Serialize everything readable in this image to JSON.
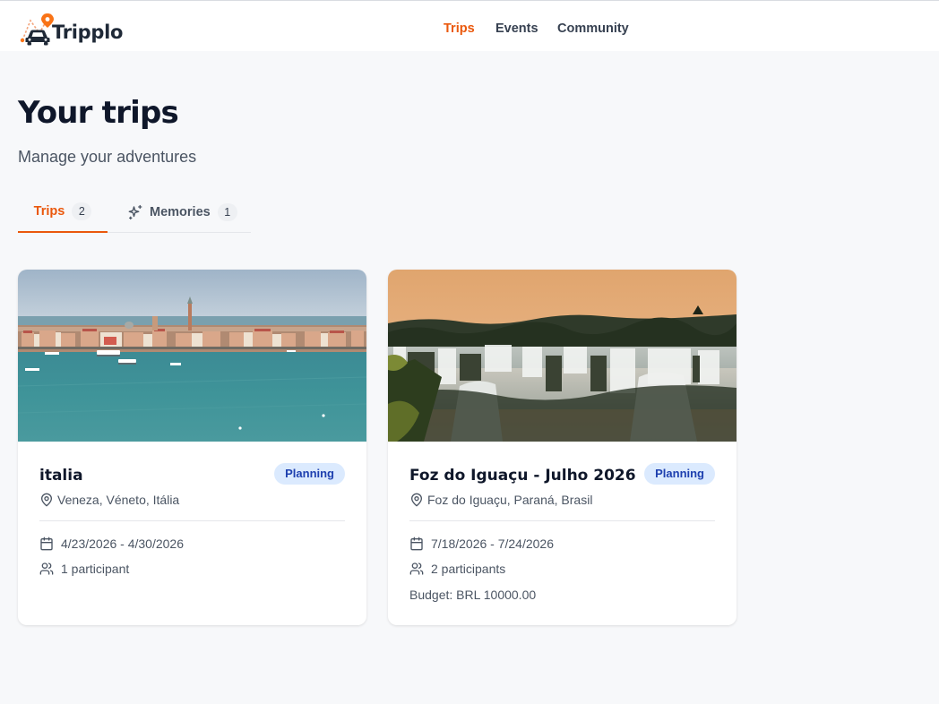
{
  "app": {
    "name": "Tripplo",
    "colors": {
      "accent": "#ea580c",
      "badge_bg": "#dbeafe",
      "badge_text": "#1e40af"
    }
  },
  "nav": {
    "items": [
      {
        "label": "Trips",
        "active": true
      },
      {
        "label": "Events",
        "active": false
      },
      {
        "label": "Community",
        "active": false
      }
    ]
  },
  "page": {
    "title": "Your trips",
    "subtitle": "Manage your adventures"
  },
  "tabs": [
    {
      "label": "Trips",
      "count": "2",
      "active": true,
      "icon": ""
    },
    {
      "label": "Memories",
      "count": "1",
      "active": false,
      "icon": "sparkles-icon"
    }
  ],
  "trips": [
    {
      "title": "italia",
      "status": "Planning",
      "location": "Veneza, Véneto, Itália",
      "dates": "4/23/2026 - 4/30/2026",
      "participants": "1 participant",
      "budget": "",
      "image": "venice-harbor-photo"
    },
    {
      "title": "Foz do Iguaçu - Julho 2026",
      "status": "Planning",
      "location": "Foz do Iguaçu, Paraná, Brasil",
      "dates": "7/18/2026 - 7/24/2026",
      "participants": "2 participants",
      "budget": "Budget: BRL 10000.00",
      "image": "iguazu-falls-photo"
    }
  ]
}
